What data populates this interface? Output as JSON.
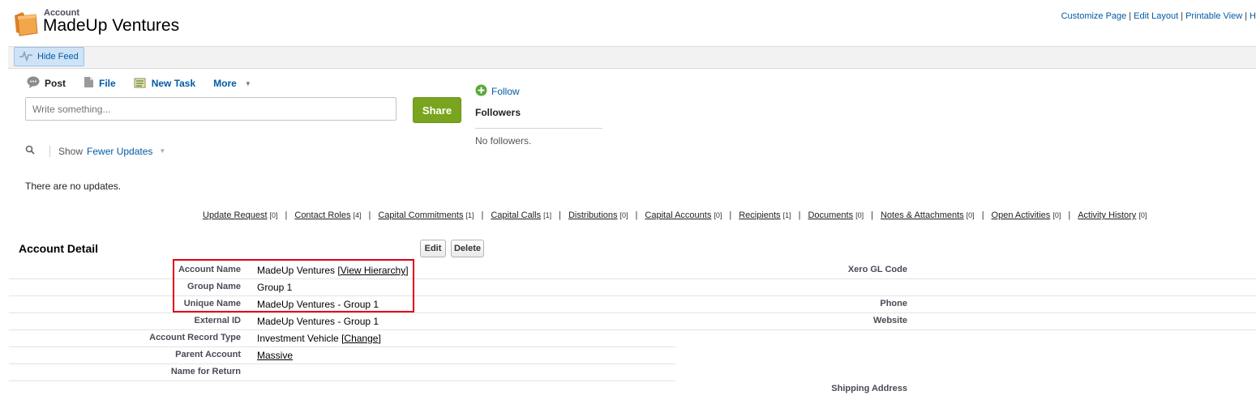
{
  "header": {
    "object_label": "Account",
    "title": "MadeUp Ventures",
    "links": {
      "customize": "Customize Page",
      "edit_layout": "Edit Layout",
      "printable": "Printable View",
      "help": "H",
      "sep": "|"
    }
  },
  "feed": {
    "hide_feed": "Hide Feed",
    "actions": {
      "post": "Post",
      "file": "File",
      "new_task": "New Task",
      "more": "More"
    },
    "input_placeholder": "Write something...",
    "share": "Share",
    "filter": {
      "show": "Show",
      "fewer_updates": "Fewer Updates"
    },
    "no_updates": "There are no updates."
  },
  "followers": {
    "follow": "Follow",
    "title": "Followers",
    "empty": "No followers."
  },
  "related_links": [
    {
      "label": "Update Request",
      "count": "[0]"
    },
    {
      "label": "Contact Roles",
      "count": "[4]"
    },
    {
      "label": "Capital Commitments",
      "count": "[1]"
    },
    {
      "label": "Capital Calls",
      "count": "[1]"
    },
    {
      "label": "Distributions",
      "count": "[0]"
    },
    {
      "label": "Capital Accounts",
      "count": "[0]"
    },
    {
      "label": "Recipients",
      "count": "[1]"
    },
    {
      "label": "Documents",
      "count": "[0]"
    },
    {
      "label": "Notes & Attachments",
      "count": "[0]"
    },
    {
      "label": "Open Activities",
      "count": "[0]"
    },
    {
      "label": "Activity History",
      "count": "[0]"
    }
  ],
  "detail": {
    "title": "Account Detail",
    "edit": "Edit",
    "delete": "Delete",
    "fields": {
      "account_name": {
        "label": "Account Name",
        "value": "MadeUp Ventures",
        "link": "View Hierarchy"
      },
      "group_name": {
        "label": "Group Name",
        "value": "Group 1"
      },
      "unique_name": {
        "label": "Unique Name",
        "value": "MadeUp Ventures - Group 1"
      },
      "external_id": {
        "label": "External ID",
        "value": "MadeUp Ventures - Group 1"
      },
      "record_type": {
        "label": "Account Record Type",
        "value": "Investment Vehicle",
        "link": "Change"
      },
      "parent_account": {
        "label": "Parent Account",
        "value": "Massive"
      },
      "name_for_return": {
        "label": "Name for Return",
        "value": ""
      }
    },
    "right_fields": {
      "xero": "Xero GL Code",
      "phone": "Phone",
      "website": "Website",
      "shipping": "Shipping Address"
    }
  },
  "colors": {
    "link": "#015ba7",
    "share_button": "#79a51e",
    "highlight_box": "#e2001a"
  },
  "icons": [
    "folder-icon",
    "feed-pulse-icon",
    "chat-bubble-icon",
    "file-icon",
    "task-icon",
    "dropdown-arrow-icon",
    "search-icon",
    "plus-circle-icon"
  ]
}
